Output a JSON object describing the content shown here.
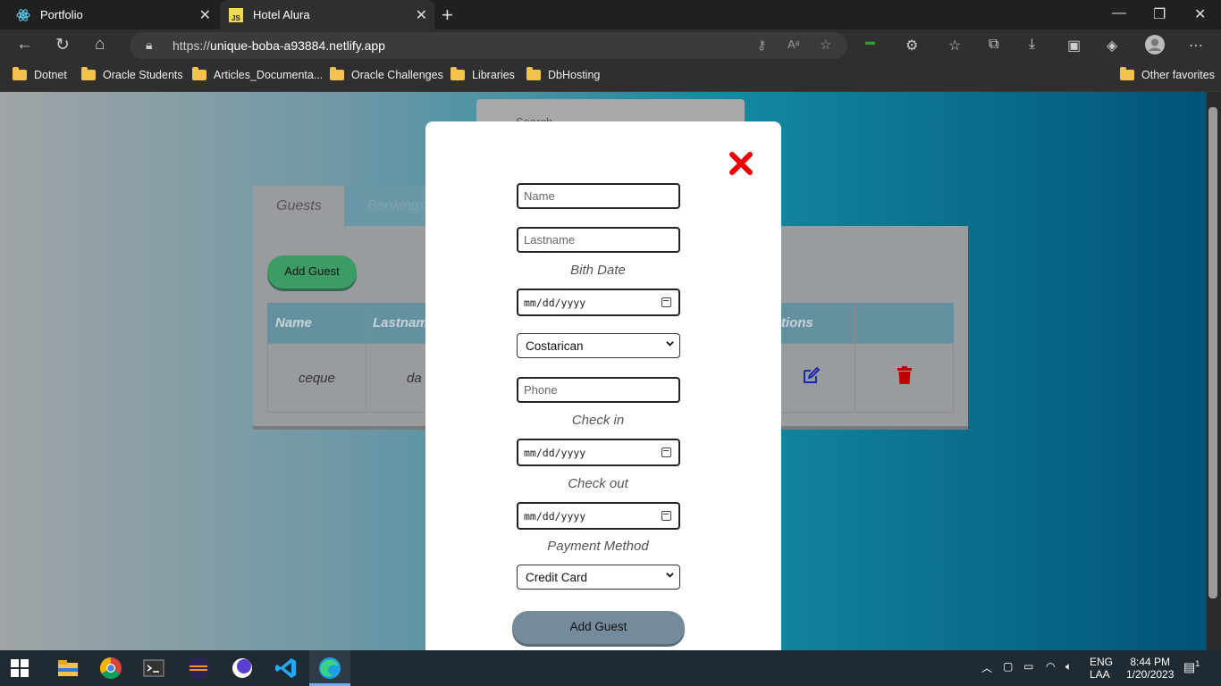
{
  "browser": {
    "tabs": [
      {
        "title": "Portfolio"
      },
      {
        "title": "Hotel Alura",
        "active": true
      }
    ],
    "url_prefix": "https://",
    "url_host": "unique-boba-a93884.netlify.app",
    "favorites": [
      "Dotnet",
      "Oracle Students",
      "Articles_Documenta...",
      "Oracle Challenges",
      "Libraries",
      "DbHosting"
    ],
    "other_favorites": "Other favorites"
  },
  "page": {
    "search_placeholder": "Search",
    "tabs": [
      "Guests",
      "Bookings"
    ],
    "add_guest_label": "Add Guest",
    "table": {
      "headers": [
        "Name",
        "Lastname",
        "Actions"
      ],
      "header_partial": [
        "Name",
        "Lastnam",
        "tions"
      ],
      "rows": [
        {
          "name": "ceque",
          "lastname_partial": "da"
        }
      ]
    }
  },
  "modal": {
    "name_placeholder": "Name",
    "lastname_placeholder": "Lastname",
    "birth_date_label": "Bith Date",
    "date_placeholder": "mm/dd/yyyy",
    "nationality_value": "Costarican",
    "phone_placeholder": "Phone",
    "check_in_label": "Check in",
    "check_out_label": "Check out",
    "payment_method_label": "Payment Method",
    "payment_method_value": "Credit Card",
    "submit_label": "Add Guest"
  },
  "system": {
    "lang": "ENG",
    "lang_sub": "LAA",
    "time": "8:44 PM",
    "date": "1/20/2023",
    "notification_count": "1"
  },
  "colors": {
    "close_icon": "#ee0000",
    "edit_icon": "#1a2aa8",
    "delete_icon": "#c00000",
    "add_guest_green": "#3d9b66"
  }
}
